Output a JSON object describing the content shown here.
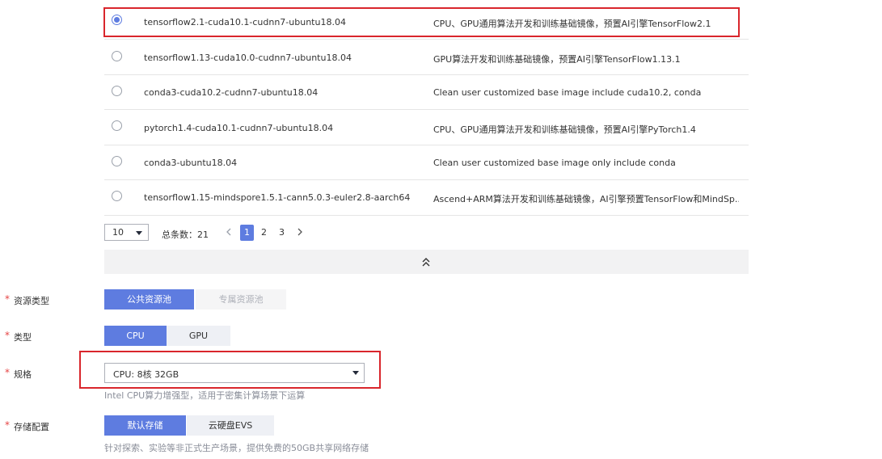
{
  "images": [
    {
      "name": "tensorflow2.1-cuda10.1-cudnn7-ubuntu18.04",
      "desc": "CPU、GPU通用算法开发和训练基础镜像，预置AI引擎TensorFlow2.1",
      "selected": true
    },
    {
      "name": "tensorflow1.13-cuda10.0-cudnn7-ubuntu18.04",
      "desc": "GPU算法开发和训练基础镜像，预置AI引擎TensorFlow1.13.1",
      "selected": false
    },
    {
      "name": "conda3-cuda10.2-cudnn7-ubuntu18.04",
      "desc": "Clean user customized base image include cuda10.2, conda",
      "selected": false
    },
    {
      "name": "pytorch1.4-cuda10.1-cudnn7-ubuntu18.04",
      "desc": "CPU、GPU通用算法开发和训练基础镜像，预置AI引擎PyTorch1.4",
      "selected": false
    },
    {
      "name": "conda3-ubuntu18.04",
      "desc": "Clean user customized base image only include conda",
      "selected": false
    },
    {
      "name": "tensorflow1.15-mindspore1.5.1-cann5.0.3-euler2.8-aarch64",
      "desc": "Ascend+ARM算法开发和训练基础镜像，AI引擎预置TensorFlow和MindSp...",
      "selected": false
    }
  ],
  "pagination": {
    "page_size": "10",
    "total_label": "总条数：21",
    "pages": [
      "1",
      "2",
      "3"
    ],
    "current_page": "1"
  },
  "colors": {
    "accent": "#5e7ce0",
    "highlight": "#d9262c",
    "required": "#e54545"
  },
  "icons": {
    "prev": "chevron-left-icon",
    "next": "chevron-right-icon",
    "collapse": "double-chevron-up-icon",
    "dropdown": "caret-down-icon"
  },
  "form": {
    "resource_type": {
      "label": "资源类型",
      "options": [
        "公共资源池",
        "专属资源池"
      ],
      "selected": "公共资源池",
      "disabled": [
        "专属资源池"
      ]
    },
    "type": {
      "label": "类型",
      "options": [
        "CPU",
        "GPU"
      ],
      "selected": "CPU"
    },
    "spec": {
      "label": "规格",
      "value": "CPU: 8核 32GB",
      "hint": "Intel CPU算力增强型，适用于密集计算场景下运算"
    },
    "storage": {
      "label": "存储配置",
      "options": [
        "默认存储",
        "云硬盘EVS"
      ],
      "selected": "默认存储",
      "hint": "针对探索、实验等非正式生产场景，提供免费的50GB共享网络存储"
    }
  }
}
